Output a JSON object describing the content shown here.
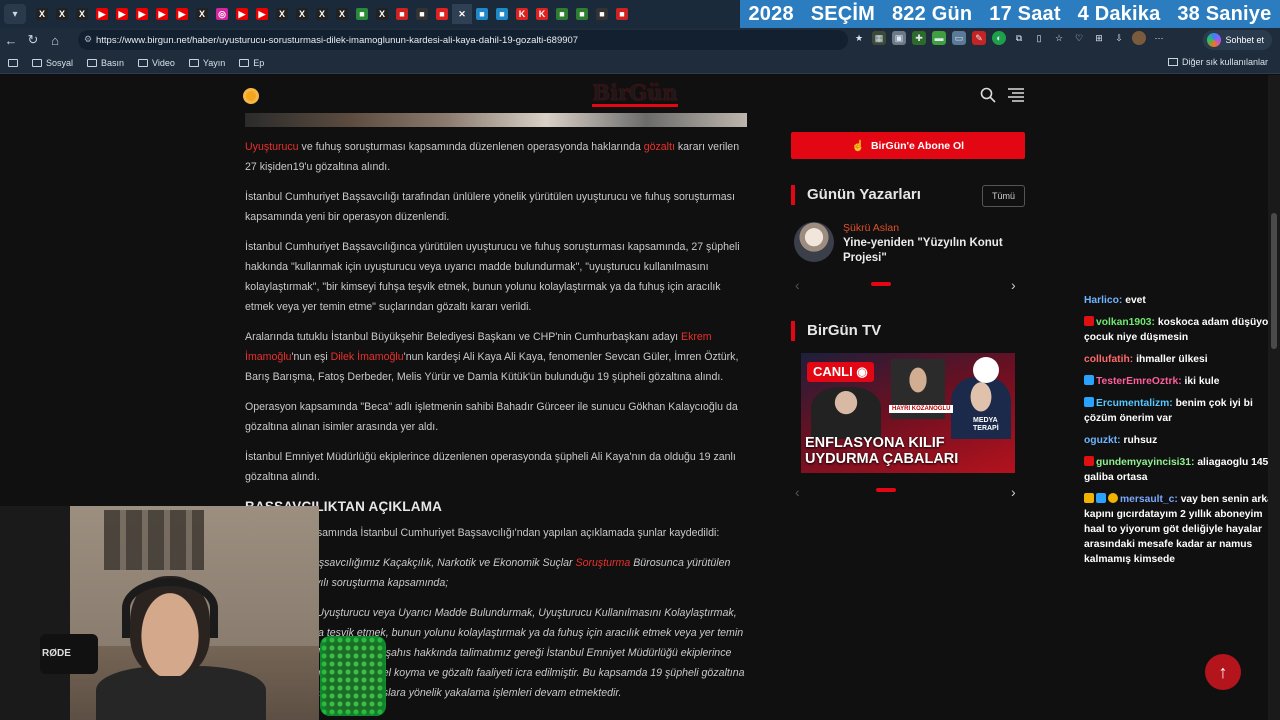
{
  "browser": {
    "countdown": {
      "years": "2028",
      "label": "SEÇİM",
      "days": "822 Gün",
      "hours": "17 Saat",
      "minutes": "4 Dakika",
      "seconds": "38 Saniye"
    },
    "url": "https://www.birgun.net/haber/uyusturucu-sorusturmasi-dilek-imamoglunun-kardesi-ali-kaya-dahil-19-gozalti-689907",
    "chat_button": "Sohbet et",
    "bookmarks": [
      "Sosyal",
      "Basın",
      "Video",
      "Yayın",
      "Ep"
    ],
    "bookmarks_right": "Diğer sık kullanılanlar"
  },
  "site": {
    "logo": "BirGün",
    "subscribe": "BirGün'e Abone Ol"
  },
  "article": {
    "p1": {
      "link1": "Uyuşturucu",
      "mid": " ve fuhuş soruşturması kapsamında düzenlenen operasyonda haklarında ",
      "link2": "gözaltı",
      "end": " kararı verilen 27 kişiden19'u gözaltına alındı."
    },
    "p2": "İstanbul Cumhuriyet Başsavcılığı tarafından ünlülere yönelik yürütülen uyuşturucu ve fuhuş soruşturması kapsamında yeni bir operasyon düzenlendi.",
    "p3": "İstanbul Cumhuriyet Başsavcılığınca yürütülen uyuşturucu ve fuhuş soruşturması kapsamında, 27 şüpheli hakkında \"kullanmak için uyuşturucu veya uyarıcı madde bulundurmak\", \"uyuşturucu kullanılmasını kolaylaştırmak\", \"bir kimseyi fuhşa teşvik etmek, bunun yolunu kolaylaştırmak ya da fuhuş için aracılık etmek veya yer temin etme\" suçlarından gözaltı kararı verildi.",
    "p4": {
      "start": "Aralarında tutuklu İstanbul Büyükşehir Belediyesi Başkanı ve CHP'nin Cumhurbaşkanı adayı ",
      "link1": "Ekrem İmamoğlu",
      "mid": "'nun eşi ",
      "link2": "Dilek İmamoğlu",
      "end": "'nun kardeşi Ali Kaya Ali Kaya, fenomenler Sevcan Güler, İmren Öztürk, Barış Barışma, Fatoş Derbeder, Melis Yürür ve Damla Kütük'ün bulunduğu 19 şüpheli gözaltına alındı."
    },
    "p5": "Operasyon kapsamında \"Beca\" adlı işletmenin sahibi Bahadır Gürceer ile sunucu Gökhan Kalaycıoğlu da gözaltına alınan isimler arasında yer aldı.",
    "p6": "İstanbul Emniyet Müdürlüğü ekiplerince düzenlenen operasyonda şüpheli Ali Kaya'nın da olduğu 19 zanlı gözaltına alındı.",
    "heading": "BAŞSAVCILIKTAN AÇIKLAMA",
    "p7": "Operasyon kapsamında İstanbul Cumhuriyet Başsavcılığı'ndan yapılan açıklamada şunlar kaydedildi:",
    "q1": {
      "start": "\"Cumhuriyet Başsavcılığımız Kaçakçılık, Narkotik ve Ekonomik Suçlar ",
      "link": "Soruşturma",
      "end": " Bürosunca yürütülen 2026/22490 sayılı soruşturma kapsamında;"
    },
    "q2": "Kullanmak için Uyuşturucu veya Uyarıcı Madde Bulundurmak, Uyuşturucu Kullanılmasını Kolaylaştırmak, bir kimseyi fuhşa teşvik etmek, bunun yolunu kolaylaştırmak ya da fuhuş için aracılık etmek veya yer temin etmek suçlarından 27 şüpheli şahıs hakkında talimatımız gereği İstanbul Emniyet Müdürlüğü ekiplerince yakalama, aramadan arama, el koyma ve gözaltı faaliyeti icra edilmiştir. Bu kapsamda 19 şüpheli gözaltına alınmış olup firar şüpheli şahıslara yönelik yakalama işlemleri devam etmektedir."
  },
  "sidebar": {
    "writers_title": "Günün Yazarları",
    "all_button": "Tümü",
    "author_name": "Şükrü Aslan",
    "author_headline": "Yine-yeniden \"Yüzyılın Konut Projesi\"",
    "tv_title": "BirGün TV",
    "tv_live": "CANLI",
    "tv_guest": "HAYRİ KOZANOĞLU",
    "tv_show": "MEDYA TERAPİ",
    "tv_caption": "ENFLASYONA KILIF UYDURMA ÇABALARI"
  },
  "chat": [
    {
      "user": "Harlico:",
      "text": "evet",
      "color": "#6fb4ff"
    },
    {
      "user": "volkan1903:",
      "text": "koskoca adam düşüyor çocuk niye düşmesin",
      "color": "#6fe86f",
      "badge": "#d11"
    },
    {
      "user": "collufatih:",
      "text": "ihmaller ülkesi",
      "color": "#ff6a6a"
    },
    {
      "user": "TesterEmreOztrk:",
      "text": "iki kule",
      "color": "#ff5f9a",
      "badge": "#2aa3ff"
    },
    {
      "user": "Ercumentalizm:",
      "text": "benim çok iyi bi çözüm önerim var",
      "color": "#55c8ff",
      "badge": "#2aa3ff"
    },
    {
      "user": "oguzkt:",
      "text": "ruhsuz",
      "color": "#6fb4ff"
    },
    {
      "user": "gundemyayincisi31:",
      "text": "aliagaoglu 1453 galiba ortasa",
      "color": "#8ef08e",
      "badge": "#d11"
    },
    {
      "user": "mersault_c:",
      "text": "vay ben senin arka kapını gıcırdatayım 2 yıllık aboneyim haal to yiyorum göt deliğiyle hayalar arasındaki mesafe kadar ar namus kalmamış kimsede",
      "color": "#7aa7ff",
      "badge": "#f0b400"
    }
  ],
  "webcam": {
    "mic_label": "RØDE"
  }
}
